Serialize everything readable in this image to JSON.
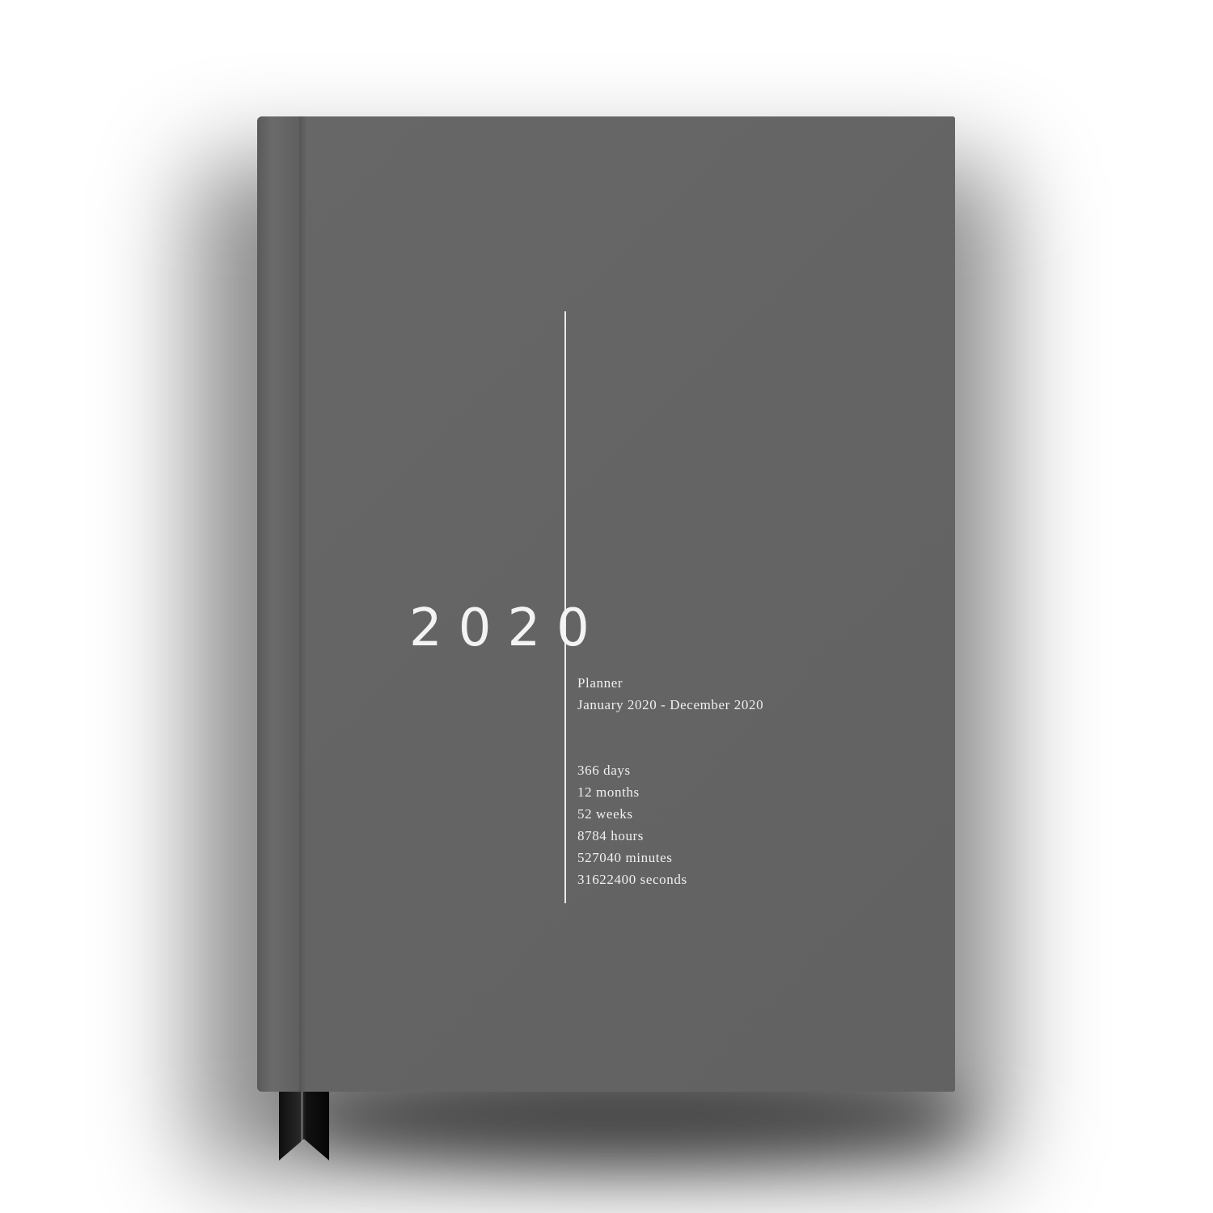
{
  "cover": {
    "year": "2020",
    "subtitle": "Planner",
    "date_range": "January 2020 - December 2020",
    "stats": [
      "366 days",
      "12 months",
      "52 weeks",
      "8784 hours",
      "527040 minutes",
      "31622400 seconds"
    ]
  },
  "colors": {
    "cover": "#646464",
    "text": "#f0f0f0",
    "ribbon": "#111111",
    "background": "#ffffff"
  }
}
